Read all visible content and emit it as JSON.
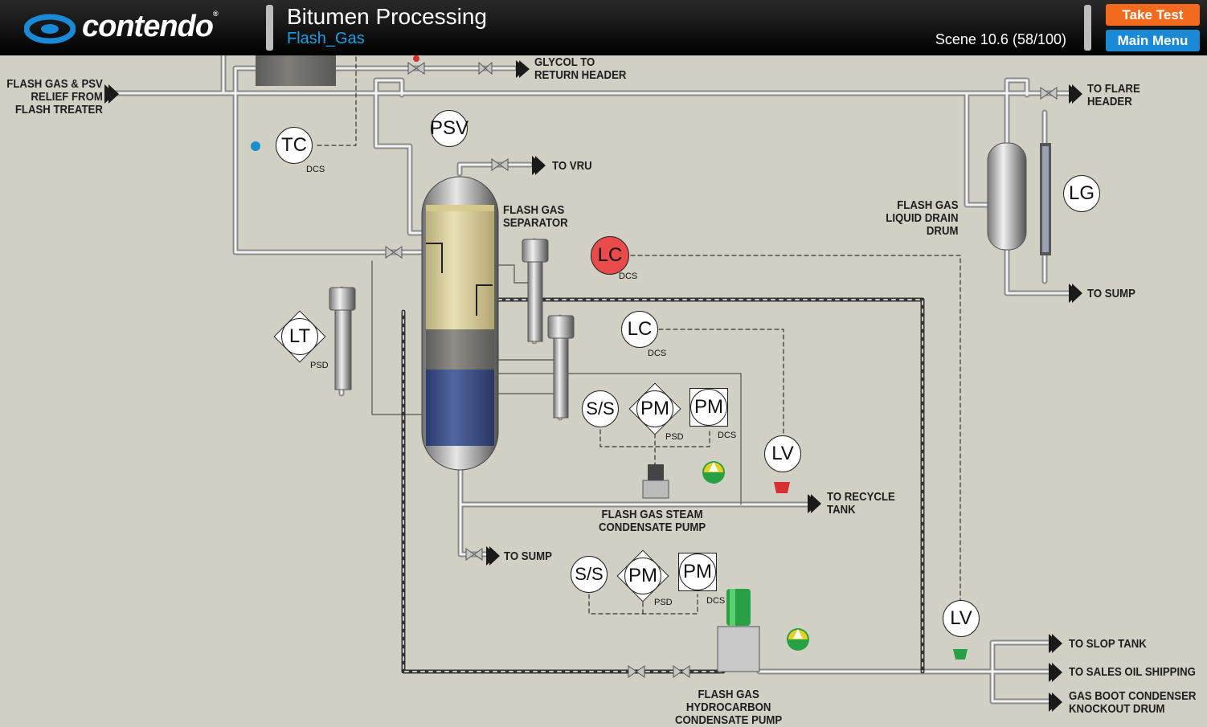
{
  "header": {
    "logo_text": "contendo",
    "logo_mark": "®",
    "title": "Bitumen Processing",
    "scene_name": "Flash_Gas",
    "scene_progress": "Scene 10.6 (58/100)",
    "take_test_label": "Take Test",
    "main_menu_label": "Main Menu",
    "colors": {
      "take_test": "#f26b1d",
      "main_menu": "#1b8ad6",
      "scene_name": "#19a0e0",
      "alarm": "#e94a4a"
    }
  },
  "labels": {
    "inlet": "FLASH GAS & PSV\nRELIEF FROM\nFLASH TREATER",
    "glycol": "GLYCOL TO\nRETURN HEADER",
    "flare": "TO FLARE\nHEADER",
    "vru": "TO VRU",
    "separator": "FLASH GAS\nSEPARATOR",
    "drain_drum": "FLASH GAS\nLIQUID DRAIN\nDRUM",
    "sump_top": "TO SUMP",
    "sump_bottom": "TO SUMP",
    "recycle": "TO RECYCLE\nTANK",
    "steam_pump": "FLASH GAS STEAM\nCONDENSATE PUMP",
    "hc_pump": "FLASH GAS\nHYDROCARBON\nCONDENSATE PUMP",
    "slop": "TO SLOP TANK",
    "sales": "TO SALES OIL SHIPPING",
    "gasboot": "GAS BOOT CONDENSER\nKNOCKOUT DRUM"
  },
  "instruments": {
    "tc": {
      "label": "TC",
      "tag": "DCS"
    },
    "psv": {
      "label": "PSV"
    },
    "lt": {
      "label": "LT",
      "tag": "PSD"
    },
    "lc1": {
      "label": "LC",
      "tag": "DCS",
      "state": "alarm"
    },
    "lc2": {
      "label": "LC",
      "tag": "DCS"
    },
    "lg": {
      "label": "LG"
    },
    "lv1": {
      "label": "LV"
    },
    "lv2": {
      "label": "LV"
    },
    "ss1": {
      "label": "S/S"
    },
    "pm1": {
      "label": "PM",
      "tag": "PSD"
    },
    "pm2": {
      "label": "PM",
      "tag": "DCS"
    },
    "ss2": {
      "label": "S/S"
    },
    "pm3": {
      "label": "PM",
      "tag": "PSD"
    },
    "pm4": {
      "label": "PM",
      "tag": "DCS"
    }
  }
}
